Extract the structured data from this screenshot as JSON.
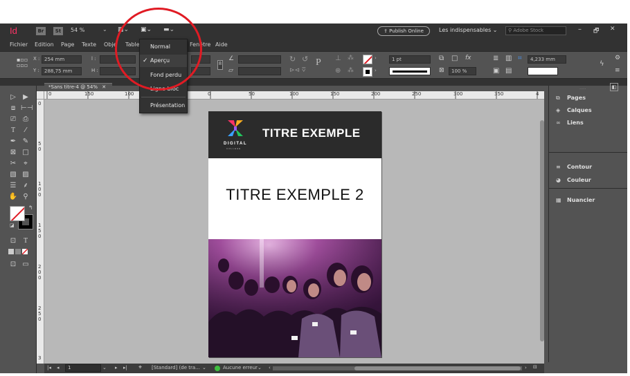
{
  "app": {
    "logo": "Id",
    "badge_br": "Br",
    "badge_st": "St",
    "zoom": "54 %",
    "publish_label": "Publish Online",
    "workspace_label": "Les indispensables",
    "search_placeholder": "Adobe Stock",
    "window_controls": [
      "–",
      "🗗",
      "✕"
    ]
  },
  "menu": {
    "items": [
      "Fichier",
      "Edition",
      "Page",
      "Texte",
      "Obje",
      "Table",
      "Fenêtre",
      "Aide"
    ]
  },
  "control_panel": {
    "x_label": "X :",
    "x_value": "254 mm",
    "y_label": "Y :",
    "y_value": "288,75 mm",
    "w_label": "l :",
    "h_label": "H :",
    "stroke_weight": "1 pt",
    "opacity": "100 %",
    "gutter": "4,233 mm"
  },
  "document_tab": {
    "label": "*Sans titre-4 @ 54%",
    "close": "✕"
  },
  "view_menu": {
    "items": [
      "Normal",
      "Aperçu",
      "Fond perdu",
      "Ligne-bloc",
      "Présentation"
    ],
    "checked_index": 1
  },
  "ruler": {
    "h_labels": [
      "0",
      "150",
      "100",
      "50",
      "0",
      "50",
      "100",
      "150",
      "200",
      "250",
      "300",
      "350",
      "4"
    ],
    "v_labels": [
      "0",
      "5\n0",
      "1\n0\n0",
      "1\n5\n0",
      "2\n0\n0",
      "2\n5\n0",
      "3"
    ]
  },
  "page": {
    "logo_text": "DIGITAL",
    "logo_sub": "COLLEGE",
    "title": "TITRE EXEMPLE",
    "title2": "TITRE EXEMPLE 2"
  },
  "right_panel": {
    "group1": [
      "Pages",
      "Calques",
      "Liens"
    ],
    "group2": [
      "Contour",
      "Couleur"
    ],
    "group3": [
      "Nuancier"
    ]
  },
  "status": {
    "page_number": "1",
    "style": "[Standard] (de tra...",
    "errors": "Aucune erreur"
  },
  "colors": {
    "app_bg": "#535353",
    "bar_bg": "#323232",
    "canvas": "#b8b8b8",
    "annotation": "#e01b24",
    "logo_accent": "#ff3366"
  }
}
